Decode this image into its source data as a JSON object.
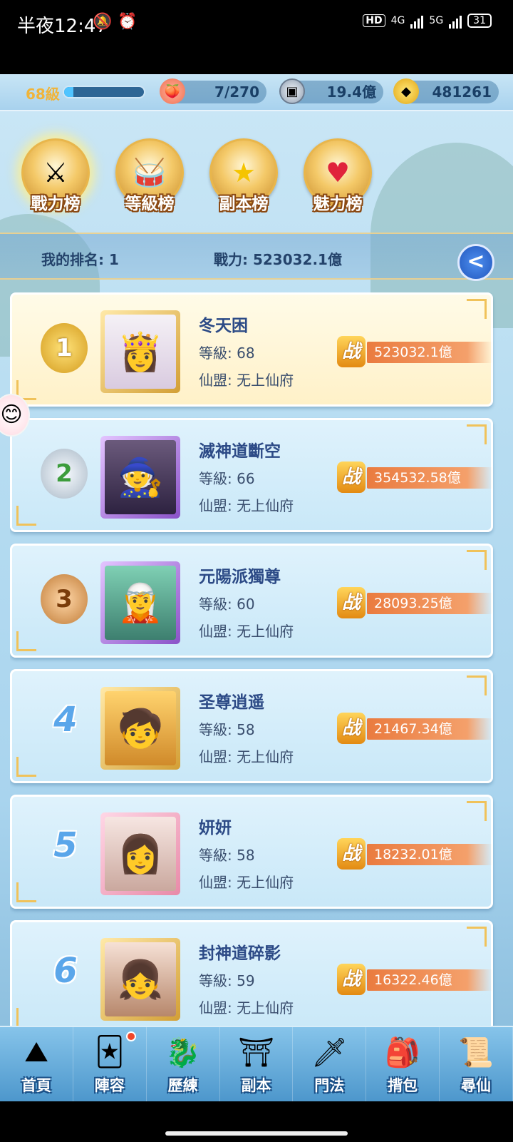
{
  "status_bar": {
    "time": "半夜12:47",
    "hd": "HD",
    "net1": "4G",
    "net2": "5G",
    "battery": "31"
  },
  "resources": {
    "level": "68級",
    "xp_fraction": 0.12,
    "stamina": "7/270",
    "coins": "19.4億",
    "gold": "481261"
  },
  "tabs": [
    {
      "label": "戰力榜",
      "icon": "sword-icon",
      "active": true
    },
    {
      "label": "等級榜",
      "icon": "drum-icon",
      "active": false
    },
    {
      "label": "副本榜",
      "icon": "star-icon",
      "active": false
    },
    {
      "label": "魅力榜",
      "icon": "heart-icon",
      "active": false
    }
  ],
  "my_rank": {
    "rank_text": "我的排名: 1",
    "power_text": "戰力: 523032.1億"
  },
  "rankings": [
    {
      "rank": "1",
      "name": "冬天困",
      "level": "等級: 68",
      "guild": "仙盟: 无上仙府",
      "power": "523032.1億"
    },
    {
      "rank": "2",
      "name": "滅神道斷空",
      "level": "等級: 66",
      "guild": "仙盟: 无上仙府",
      "power": "354532.58億"
    },
    {
      "rank": "3",
      "name": "元陽派獨尊",
      "level": "等級: 60",
      "guild": "仙盟: 无上仙府",
      "power": "28093.25億"
    },
    {
      "rank": "4",
      "name": "圣尊逍遥",
      "level": "等級: 58",
      "guild": "仙盟: 无上仙府",
      "power": "21467.34億"
    },
    {
      "rank": "5",
      "name": "妍妍",
      "level": "等級: 58",
      "guild": "仙盟: 无上仙府",
      "power": "18232.01億"
    },
    {
      "rank": "6",
      "name": "封神道碎影",
      "level": "等級: 59",
      "guild": "仙盟: 无上仙府",
      "power": "16322.46億"
    }
  ],
  "power_badge": "战",
  "back_glyph": "<",
  "nav": [
    {
      "label": "首頁",
      "icon": "home-icon"
    },
    {
      "label": "陣容",
      "icon": "team-icon"
    },
    {
      "label": "歷練",
      "icon": "training-icon"
    },
    {
      "label": "副本",
      "icon": "dungeon-icon"
    },
    {
      "label": "門法",
      "icon": "sect-icon"
    },
    {
      "label": "揹包",
      "icon": "bag-icon"
    },
    {
      "label": "尋仙",
      "icon": "explore-icon"
    }
  ]
}
